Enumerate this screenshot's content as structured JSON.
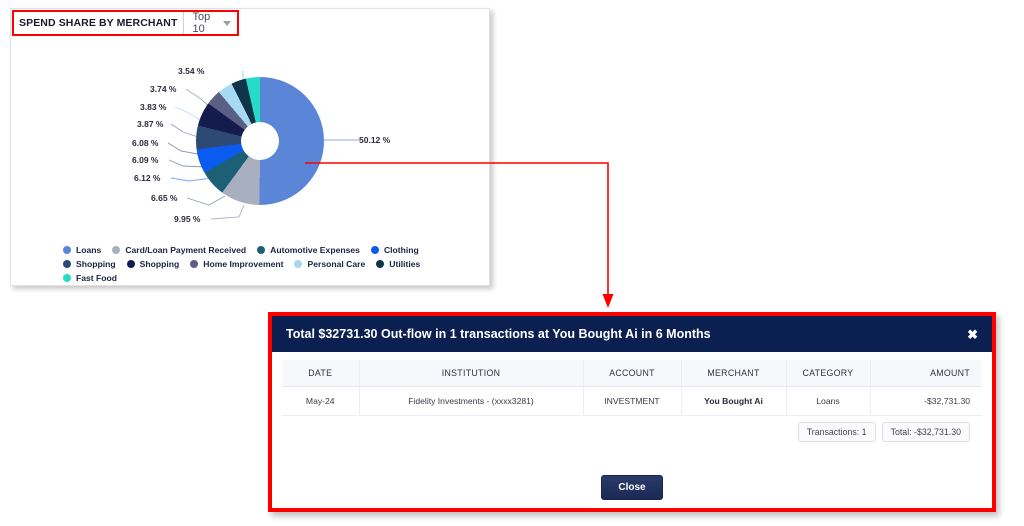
{
  "widget": {
    "title": "SPEND SHARE BY MERCHANT",
    "selected_option": "Top 10",
    "dropdown_options": [
      "Top 10"
    ],
    "chevron_icon": "chevron-down-icon"
  },
  "chart_data": {
    "type": "pie",
    "title": "SPEND SHARE BY MERCHANT",
    "subtitle": "Top 10",
    "legend_position": "bottom",
    "units": "%",
    "categories": [
      "Loans",
      "Card/Loan Payment Received",
      "Automotive Expenses",
      "Clothing",
      "Shopping",
      "Shopping",
      "Home Improvement",
      "Personal Care",
      "Utilities",
      "Fast Food"
    ],
    "values": [
      50.12,
      9.95,
      6.65,
      6.12,
      6.09,
      6.08,
      3.87,
      3.83,
      3.74,
      3.54
    ],
    "labels": [
      "50.12 %",
      "9.95 %",
      "6.65 %",
      "6.12 %",
      "6.09 %",
      "6.08 %",
      "3.87 %",
      "3.83 %",
      "3.74 %",
      "3.54 %"
    ],
    "colors": [
      "#5b86d8",
      "#a8b0c0",
      "#1d6076",
      "#0a5bf0",
      "#2c4a73",
      "#141c4d",
      "#5a5f86",
      "#a8d9f2",
      "#103449",
      "#25dcc8"
    ]
  },
  "modal": {
    "title": "Total $32731.30 Out-flow in 1 transactions at You Bought Ai in 6 Months",
    "close_icon": "close-icon",
    "columns": [
      "DATE",
      "INSTITUTION",
      "ACCOUNT",
      "MERCHANT",
      "CATEGORY",
      "AMOUNT"
    ],
    "rows": [
      {
        "date": "May-24",
        "institution": "Fidelity Investments - (xxxx3281)",
        "account": "INVESTMENT",
        "merchant": "You Bought Ai",
        "category": "Loans",
        "amount": "-$32,731.30"
      }
    ],
    "footer": {
      "transactions_chip": "Transactions: 1",
      "total_chip": "Total: -$32,731.30"
    },
    "close_button": "Close"
  },
  "annotation": {
    "highlight_color": "#ff0000"
  }
}
